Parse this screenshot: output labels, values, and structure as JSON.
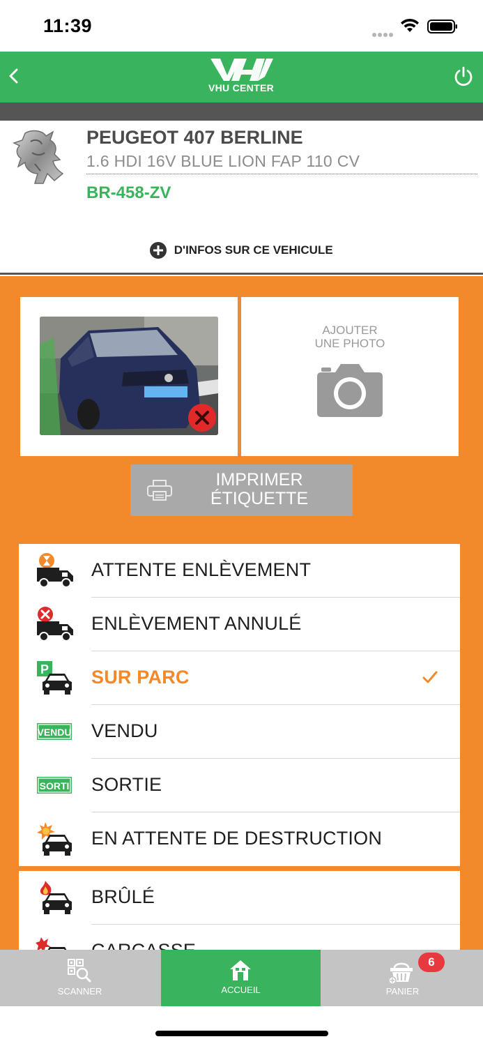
{
  "status_bar": {
    "time": "11:39"
  },
  "header": {
    "logo_text": "VHU CENTER"
  },
  "vehicle": {
    "name": "PEUGEOT 407 BERLINE",
    "version": "1.6 HDI 16V BLUE LION FAP 110 CV",
    "plate": "BR-458-ZV",
    "more_info_label": "D'INFOS SUR CE VEHICULE"
  },
  "photos": {
    "add_photo_label_line1": "AJOUTER",
    "add_photo_label_line2": "UNE PHOTO"
  },
  "print_button": {
    "line1": "IMPRIMER",
    "line2": "ÉTIQUETTE"
  },
  "statuses": [
    {
      "label": "ATTENTE ENLÈVEMENT",
      "icon": "truck-hourglass-icon"
    },
    {
      "label": "ENLÈVEMENT ANNULÉ",
      "icon": "truck-cancel-icon"
    },
    {
      "label": "SUR PARC",
      "icon": "car-parking-icon",
      "selected": true
    },
    {
      "label": "VENDU",
      "icon": "sold-tag-icon",
      "tag_text": "VENDU"
    },
    {
      "label": "SORTIE",
      "icon": "exit-tag-icon",
      "tag_text": "SORTI"
    },
    {
      "label": "EN ATTENTE DE DESTRUCTION",
      "icon": "car-explosion-icon"
    }
  ],
  "statuses_extra": [
    {
      "label": "BRÛLÉ",
      "icon": "car-fire-icon"
    },
    {
      "label": "CARCASSE",
      "icon": "car-carcass-icon"
    }
  ],
  "tabbar": {
    "scanner_label": "SCANNER",
    "home_label": "ACCUEIL",
    "cart_label": "PANIER",
    "cart_badge": "6"
  },
  "colors": {
    "brand_green": "#3ab45c",
    "accent_orange": "#f28a2b",
    "header_dark": "#555555",
    "tab_grey": "#c4c4c4",
    "badge_red": "#e8393f"
  }
}
